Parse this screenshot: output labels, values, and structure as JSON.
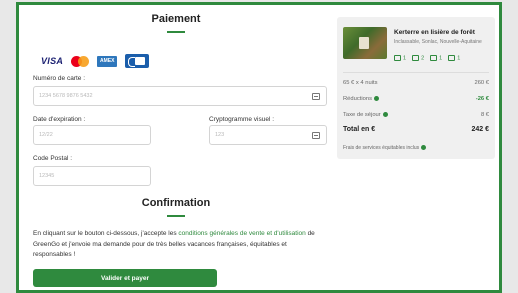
{
  "payment": {
    "title": "Paiement",
    "card_brands": [
      "VISA",
      "Mastercard",
      "AMEX",
      "CB"
    ],
    "card_number_label": "Numéro de carte :",
    "card_number_placeholder": "1234 5678 9876 5432",
    "expiry_label": "Date d'expiration :",
    "expiry_placeholder": "12/22",
    "cvv_label": "Cryptogramme visuel :",
    "cvv_placeholder": "123",
    "postal_label": "Code Postal :",
    "postal_placeholder": "12345"
  },
  "confirmation": {
    "title": "Confirmation",
    "text_before": "En cliquant sur le bouton ci-dessous, j'accepte les ",
    "link_text": "conditions générales de vente et d'utilisation",
    "text_after": " de GreenGo et j'envoie ma demande pour de très belles vacances françaises, équitables et responsables !",
    "button_label": "Valider et payer"
  },
  "summary": {
    "property_name": "Kerterre en lisière de forêt",
    "location": "Inclassable, Sonlac, Nouvelle-Aquitaine",
    "amenities": [
      "1",
      "2",
      "1",
      "1"
    ],
    "nights": {
      "label": "65 € x 4 nuits",
      "value": "260 €"
    },
    "discounts": {
      "label": "Réductions",
      "value": "-26 €"
    },
    "tax": {
      "label": "Taxe de séjour",
      "value": "8 €"
    },
    "total": {
      "label": "Total en €",
      "value": "242 €"
    },
    "fees_note": "Frais de services équitables inclus"
  },
  "colors": {
    "accent": "#2f8a3e"
  }
}
